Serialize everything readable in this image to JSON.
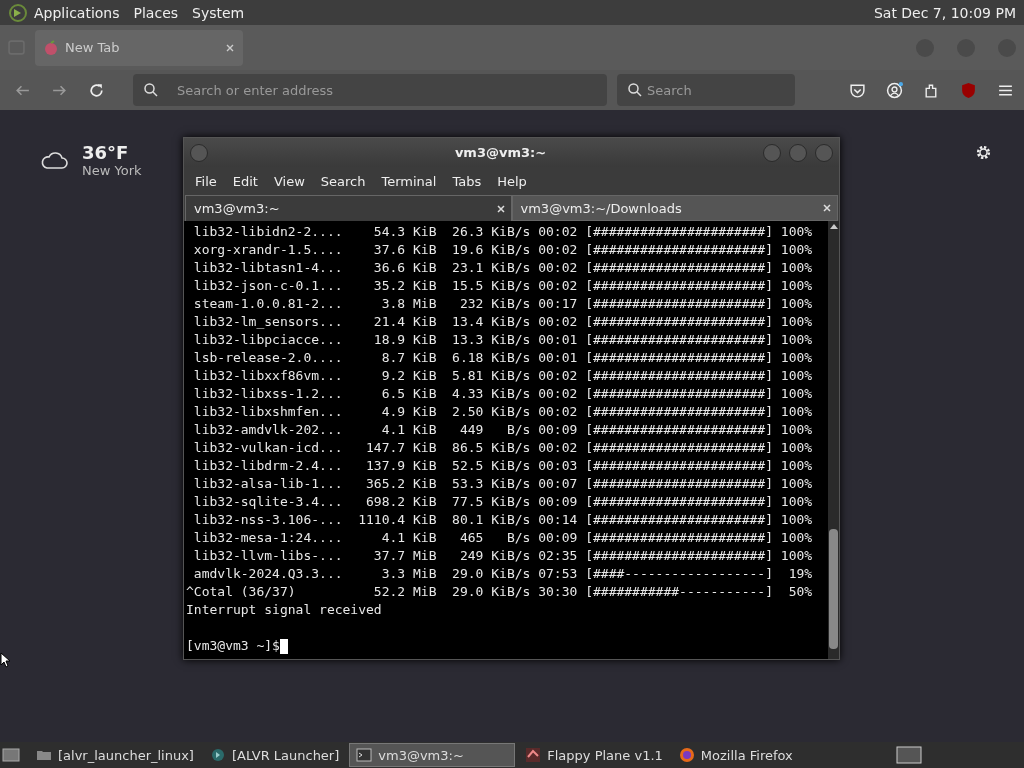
{
  "top_panel": {
    "menus": [
      "Applications",
      "Places",
      "System"
    ],
    "clock": "Sat Dec 7, 10:09 PM"
  },
  "browser": {
    "tab": {
      "title": "New Tab"
    },
    "address": {
      "placeholder": "Search or enter address"
    },
    "search": {
      "placeholder": "Search"
    },
    "weather": {
      "temperature": "36°F",
      "city": "New York"
    }
  },
  "terminal": {
    "title": "vm3@vm3:~",
    "menu": [
      "File",
      "Edit",
      "View",
      "Search",
      "Terminal",
      "Tabs",
      "Help"
    ],
    "tabs": [
      {
        "label": "vm3@vm3:~",
        "selected": true
      },
      {
        "label": "vm3@vm3:~/Downloads",
        "selected": false
      }
    ],
    "lines": [
      " lib32-libidn2-2....    54.3 KiB  26.3 KiB/s 00:02 [######################] 100%",
      " xorg-xrandr-1.5....    37.6 KiB  19.6 KiB/s 00:02 [######################] 100%",
      " lib32-libtasn1-4...    36.6 KiB  23.1 KiB/s 00:02 [######################] 100%",
      " lib32-json-c-0.1...    35.2 KiB  15.5 KiB/s 00:02 [######################] 100%",
      " steam-1.0.0.81-2...     3.8 MiB   232 KiB/s 00:17 [######################] 100%",
      " lib32-lm_sensors...    21.4 KiB  13.4 KiB/s 00:02 [######################] 100%",
      " lib32-libpciacce...    18.9 KiB  13.3 KiB/s 00:01 [######################] 100%",
      " lsb-release-2.0....     8.7 KiB  6.18 KiB/s 00:01 [######################] 100%",
      " lib32-libxxf86vm...     9.2 KiB  5.81 KiB/s 00:02 [######################] 100%",
      " lib32-libxss-1.2...     6.5 KiB  4.33 KiB/s 00:02 [######################] 100%",
      " lib32-libxshmfen...     4.9 KiB  2.50 KiB/s 00:02 [######################] 100%",
      " lib32-amdvlk-202...     4.1 KiB   449   B/s 00:09 [######################] 100%",
      " lib32-vulkan-icd...   147.7 KiB  86.5 KiB/s 00:02 [######################] 100%",
      " lib32-libdrm-2.4...   137.9 KiB  52.5 KiB/s 00:03 [######################] 100%",
      " lib32-alsa-lib-1...   365.2 KiB  53.3 KiB/s 00:07 [######################] 100%",
      " lib32-sqlite-3.4...   698.2 KiB  77.5 KiB/s 00:09 [######################] 100%",
      " lib32-nss-3.106-...  1110.4 KiB  80.1 KiB/s 00:14 [######################] 100%",
      " lib32-mesa-1:24....     4.1 KiB   465   B/s 00:09 [######################] 100%",
      " lib32-llvm-libs-...    37.7 MiB   249 KiB/s 02:35 [######################] 100%",
      " amdvlk-2024.Q3.3...     3.3 MiB  29.0 KiB/s 07:53 [####------------------]  19%",
      "^Cotal (36/37)          52.2 MiB  29.0 KiB/s 30:30 [###########-----------]  50%",
      "Interrupt signal received"
    ],
    "prompt": "[vm3@vm3 ~]$"
  },
  "taskbar": {
    "items": [
      {
        "label": "[alvr_launcher_linux]",
        "kind": "folder",
        "selected": false
      },
      {
        "label": "[ALVR Launcher]",
        "kind": "app",
        "selected": false
      },
      {
        "label": "vm3@vm3:~",
        "kind": "terminal",
        "selected": true
      },
      {
        "label": "Flappy Plane v1.1",
        "kind": "game",
        "selected": false
      },
      {
        "label": "Mozilla Firefox",
        "kind": "browser",
        "selected": false
      }
    ]
  }
}
